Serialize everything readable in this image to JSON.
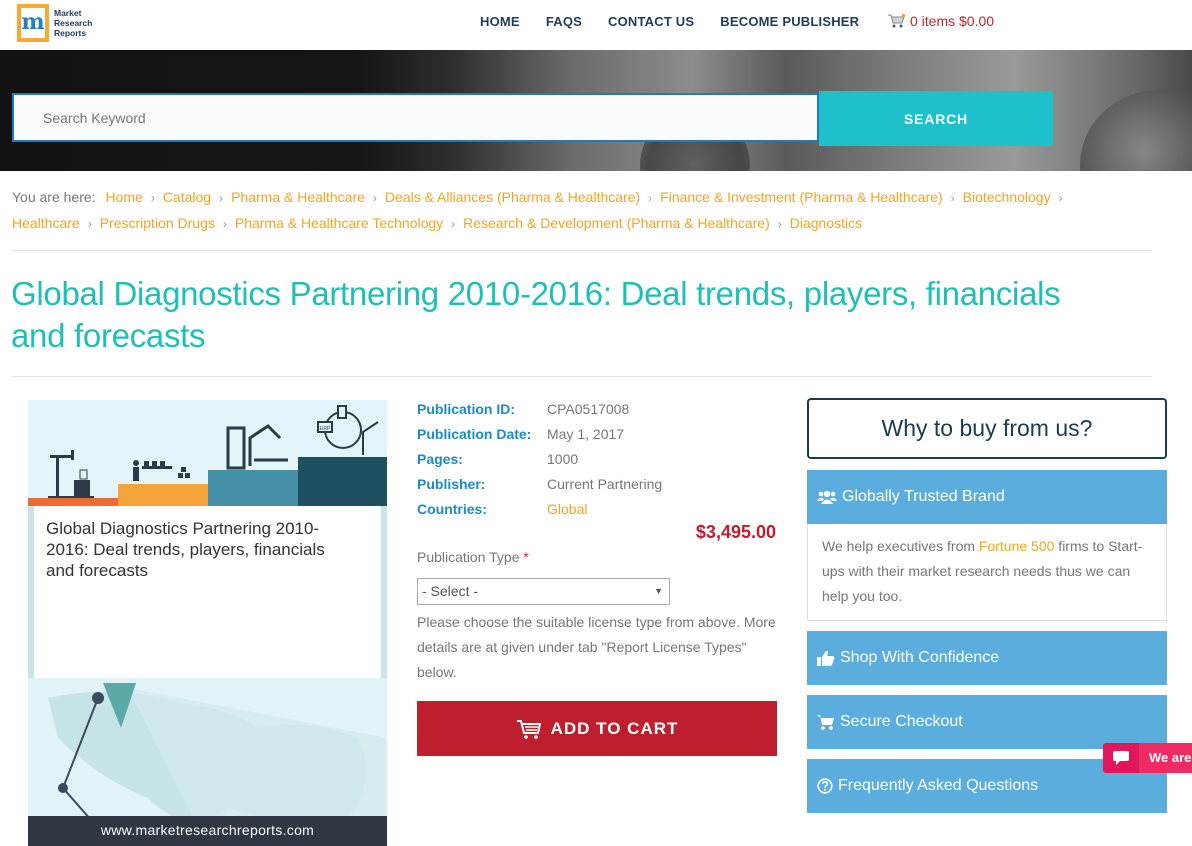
{
  "header": {
    "logo": {
      "mark": "m",
      "lines": [
        "Market",
        "Research",
        "Reports"
      ],
      "registered": "®"
    },
    "nav": [
      {
        "label": "HOME"
      },
      {
        "label": "FAQS"
      },
      {
        "label": "CONTACT US"
      },
      {
        "label": "BECOME PUBLISHER"
      }
    ],
    "cart": {
      "icon": "shopping-cart-icon",
      "label": "0 items $0.00"
    }
  },
  "search": {
    "placeholder": "Search Keyword",
    "value": "",
    "button_label": "SEARCH"
  },
  "breadcrumb": {
    "prefix": "You are here:",
    "items": [
      "Home",
      "Catalog",
      "Pharma & Healthcare",
      "Deals & Alliances (Pharma & Healthcare)",
      "Finance & Investment (Pharma & Healthcare)",
      "Biotechnology",
      "Healthcare",
      "Prescription Drugs",
      "Pharma & Healthcare Technology",
      "Research & Development (Pharma & Healthcare)",
      "Diagnostics"
    ]
  },
  "report": {
    "title": "Global Diagnostics Partnering 2010-2016: Deal trends, players, financials and forecasts",
    "cover": {
      "title": "Global Diagnostics Partnering 2010-2016: Deal trends, players, financials and forecasts",
      "url": "www.marketresearchreports.com",
      "erp_label": "ERP"
    },
    "details": [
      {
        "label": "Publication ID:",
        "value": "CPA0517008"
      },
      {
        "label": "Publication Date:",
        "value": "May 1, 2017"
      },
      {
        "label": "Pages:",
        "value": "1000"
      },
      {
        "label": "Publisher:",
        "value": "Current Partnering"
      },
      {
        "label": "Countries:",
        "value": "Global"
      }
    ],
    "price": "$3,495.00",
    "publication_type": {
      "label": "Publication Type",
      "required_mark": "*",
      "selected": "- Select -"
    },
    "help_text": "Please choose the suitable license type from above. More details are at given under tab \"Report License Types\" below.",
    "add_to_cart_label": "ADD TO CART"
  },
  "sidebar": {
    "why_title": "Why to buy from us?",
    "panels": [
      {
        "icon": "users-icon",
        "title": "Globally Trusted Brand",
        "body_before": "We help executives from ",
        "body_highlight": "Fortune 500",
        "body_after": " firms to Start-ups with their market research needs thus we can help you too."
      },
      {
        "icon": "thumbs-up-icon",
        "title": "Shop With Confidence"
      },
      {
        "icon": "shopping-cart-icon",
        "title": "Secure Checkout"
      },
      {
        "icon": "question-circle-icon",
        "title": "Frequently Asked Questions"
      }
    ]
  },
  "chat": {
    "icon": "chat-bubble-icon",
    "label": "We are"
  },
  "colors": {
    "brand_teal": "#1ec0b6",
    "search_button": "#1ec0c9",
    "link_orange": "#f4a51c",
    "label_blue": "#1a8ac9",
    "price_red": "#bd1e2d",
    "cart_button": "#bf1e2e",
    "panel_blue": "#5aaddc",
    "nav_dark": "#1e3d5a",
    "chat_pink": "#f02a63"
  }
}
